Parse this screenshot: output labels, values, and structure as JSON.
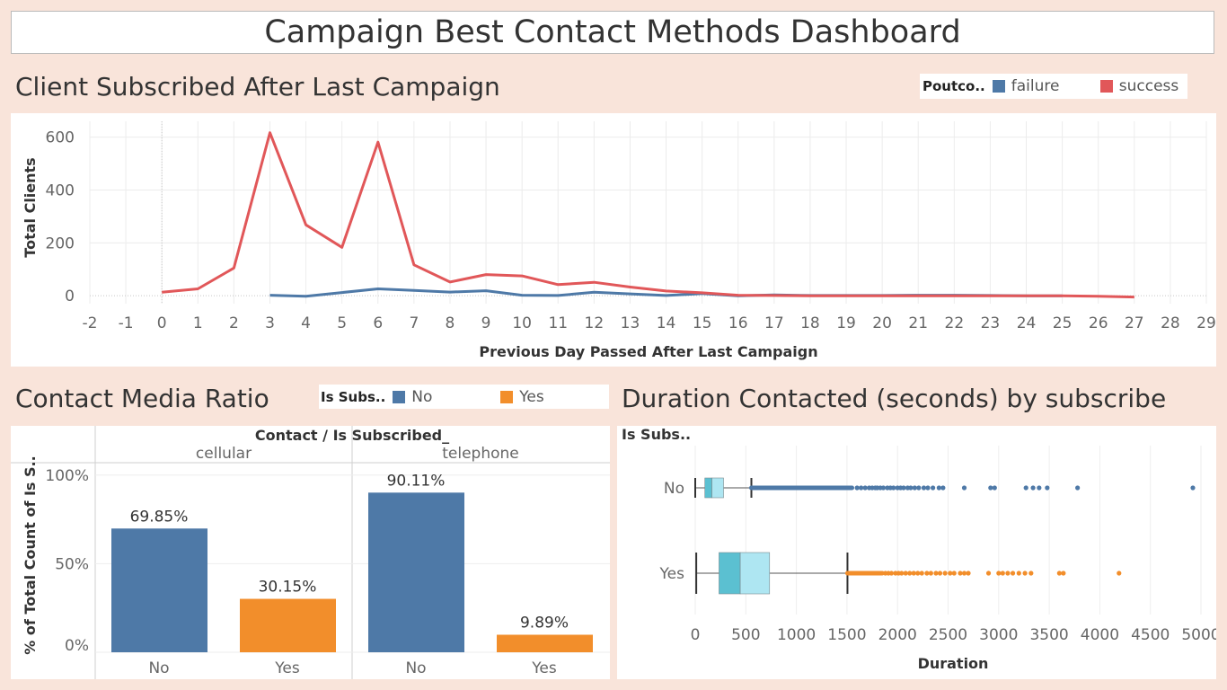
{
  "dashboard": {
    "title": "Campaign Best Contact Methods Dashboard"
  },
  "line_section": {
    "title": "Client Subscribed After Last Campaign",
    "legend_title": "Poutco..",
    "legend_items": [
      {
        "label": "failure",
        "color": "#4e79a7"
      },
      {
        "label": "success",
        "color": "#e15759"
      }
    ]
  },
  "bar_section": {
    "title": "Contact Media Ratio",
    "legend_title": "Is Subs..",
    "legend_items": [
      {
        "label": "No",
        "color": "#4e79a7"
      },
      {
        "label": "Yes",
        "color": "#f28e2b"
      }
    ]
  },
  "box_section": {
    "title": "Duration Contacted (seconds) by subscribe",
    "row_header": "Is Subs.."
  },
  "chart_data": [
    {
      "type": "line",
      "xlabel": "Previous Day Passed After Last Campaign",
      "ylabel": "Total Clients",
      "xlim": [
        -2,
        29
      ],
      "ylim": [
        -30,
        660
      ],
      "xticks": [
        -2,
        -1,
        0,
        1,
        2,
        3,
        4,
        5,
        6,
        7,
        8,
        9,
        10,
        11,
        12,
        13,
        14,
        15,
        16,
        17,
        18,
        19,
        20,
        21,
        22,
        23,
        24,
        25,
        26,
        27,
        28,
        29
      ],
      "yticks": [
        0,
        200,
        400,
        600
      ],
      "grid": true,
      "legend_position": "top-right",
      "series": [
        {
          "name": "failure",
          "color": "#4e79a7",
          "x": [
            3,
            4,
            5,
            6,
            7,
            8,
            9,
            10,
            11,
            12,
            13,
            14,
            15,
            16,
            17,
            18,
            19,
            20,
            21,
            22,
            23,
            24,
            25
          ],
          "values": [
            2,
            -2,
            12,
            26,
            20,
            14,
            19,
            2,
            1,
            13,
            7,
            1,
            8,
            0,
            3,
            1,
            1,
            1,
            2,
            2,
            1,
            0,
            0
          ]
        },
        {
          "name": "success",
          "color": "#e15759",
          "x": [
            0,
            1,
            2,
            3,
            4,
            5,
            6,
            7,
            8,
            9,
            10,
            11,
            12,
            13,
            14,
            15,
            16,
            17,
            18,
            19,
            20,
            21,
            22,
            23,
            24,
            25,
            26,
            27
          ],
          "values": [
            13,
            26,
            105,
            617,
            268,
            183,
            581,
            117,
            52,
            80,
            75,
            42,
            51,
            33,
            18,
            11,
            2,
            1,
            0,
            0,
            0,
            0,
            0,
            0,
            0,
            0,
            -2,
            -5
          ]
        }
      ]
    },
    {
      "type": "bar",
      "header": "Contact / Is Subscribed_",
      "ylabel": "% of Total Count of Is S..",
      "ylim": [
        0,
        100
      ],
      "yticks": [
        "0%",
        "50%",
        "100%"
      ],
      "groups": [
        {
          "name": "cellular",
          "bars": [
            {
              "category": "No",
              "value": 69.85,
              "label": "69.85%",
              "color": "#4e79a7"
            },
            {
              "category": "Yes",
              "value": 30.15,
              "label": "30.15%",
              "color": "#f28e2b"
            }
          ]
        },
        {
          "name": "telephone",
          "bars": [
            {
              "category": "No",
              "value": 90.11,
              "label": "90.11%",
              "color": "#4e79a7"
            },
            {
              "category": "Yes",
              "value": 9.89,
              "label": "9.89%",
              "color": "#f28e2b"
            }
          ]
        }
      ]
    },
    {
      "type": "box",
      "xlabel": "Duration",
      "xlim": [
        0,
        5100
      ],
      "xticks": [
        0,
        500,
        1000,
        1500,
        2000,
        2500,
        3000,
        3500,
        4000,
        4500,
        5000
      ],
      "rows": [
        {
          "category": "No",
          "color": "#4e79a7",
          "whisker_min": 0,
          "q1": 95,
          "median": 165,
          "q3": 280,
          "whisker_max": 555,
          "outlier_range": [
            555,
            1550
          ],
          "outliers": [
            1600,
            1640,
            1680,
            1720,
            1750,
            1780,
            1800,
            1830,
            1860,
            1900,
            1930,
            1960,
            2000,
            2030,
            2060,
            2100,
            2130,
            2170,
            2210,
            2260,
            2300,
            2350,
            2410,
            2450,
            2660,
            2920,
            2960,
            3270,
            3340,
            3400,
            3480,
            3780,
            4920
          ]
        },
        {
          "category": "Yes",
          "color": "#f28e2b",
          "whisker_min": 10,
          "q1": 235,
          "median": 445,
          "q3": 735,
          "whisker_max": 1505,
          "outlier_range": [
            1505,
            1850
          ],
          "outliers": [
            1880,
            1910,
            1940,
            1980,
            2010,
            2040,
            2080,
            2120,
            2160,
            2200,
            2240,
            2290,
            2330,
            2380,
            2420,
            2470,
            2520,
            2560,
            2620,
            2660,
            2700,
            2900,
            3000,
            3040,
            3090,
            3140,
            3200,
            3260,
            3320,
            3600,
            3640,
            4190
          ]
        }
      ]
    }
  ]
}
